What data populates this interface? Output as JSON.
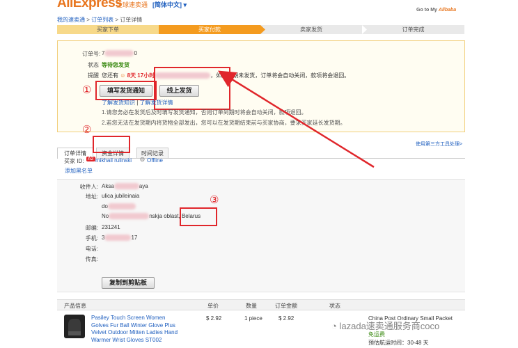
{
  "header": {
    "logo": "AliExpress",
    "logo_sub": "全球速卖通",
    "lang": "[简体中文]",
    "goto_prefix": "Go to My",
    "goto_brand": "Alibaba",
    "breadcrumb": [
      "我的速卖通",
      "订单列表",
      "订单详情"
    ]
  },
  "steps": [
    {
      "label": "买家下单",
      "state": "done"
    },
    {
      "label": "买家付款",
      "state": "active"
    },
    {
      "label": "卖家发货",
      "state": "todo"
    },
    {
      "label": "订单完成",
      "state": "todo"
    }
  ],
  "order": {
    "id_label": "订单号:",
    "id_value_start": "7",
    "id_value_end": "0",
    "status_label": "状态",
    "status_value": "等待您发货",
    "remind_label": "提醒",
    "remind_prefix": "您还有",
    "remind_time": "8天 17小时",
    "remind_text": "，如果逾期未发货，订单将会自动关闭，款项将会退回。",
    "btn_fill_notice": "填写发货通知",
    "btn_online_ship": "线上发货",
    "link_learn": "了解发货知识",
    "link_sep": "|",
    "link_detail": "了解发货详情",
    "note1": "1.请您务必在发货后及时填写发货通知，否则订单到期时将会自动关闭，款项退回。",
    "note2": "2.若您无法在发货期内将货物全部发出，您可以在发货期结束前与买家协商，要求买家延长发货期。"
  },
  "annotations": {
    "one": "①",
    "two": "②",
    "three": "③"
  },
  "tabs": {
    "order_detail": "订单详情",
    "fund_detail": "资金详情",
    "time_record": "时间记录",
    "third_party": "使用第三方工具处理>"
  },
  "buyer": {
    "id_label": "买家 ID:",
    "level_badge": "A2",
    "name": "mikhail rulinski",
    "online_status": "Offline",
    "blacklist": "添加黑名单"
  },
  "address": {
    "recipient_label": "收件人:",
    "recipient_value": "Aksa",
    "recipient_end": "aya",
    "addr_label": "地址:",
    "addr_line1": "ulica jubileinaia",
    "addr_line2": "do",
    "addr_line3_start": "No",
    "addr_line3_mid": "nskja oblast,",
    "addr_country": "Belarus",
    "zip_label": "邮编:",
    "zip_value": "231241",
    "mobile_label": "手机:",
    "mobile_start": "3",
    "mobile_end": "17",
    "phone_label": "电话:",
    "fax_label": "传真:",
    "copy_button": "复制到剪贴板"
  },
  "table": {
    "headers": [
      "产品信息",
      "单价",
      "数量",
      "订单金额",
      "状态"
    ],
    "rows": [
      {
        "title": "Pasiley Touch Screen Women Golves Fur Ball Winter Glove Plus Velvet Outdoor Mitten Ladies Hand Warmer Wrist Gloves ST002",
        "price": "$ 2.92",
        "qty": "1 piece",
        "amount": "$ 2.92",
        "shipping_method": "China Post Ordinary Small Packet",
        "free_shipping": "免运费",
        "eta": "预估航运时间：30-48 天"
      }
    ]
  },
  "watermark": "lazada速卖通服务商coco",
  "colors": {
    "accent": "#f49b1f",
    "annotation_red": "#e0262b",
    "link": "#1f5fbf",
    "status_green": "#3a8a12"
  }
}
